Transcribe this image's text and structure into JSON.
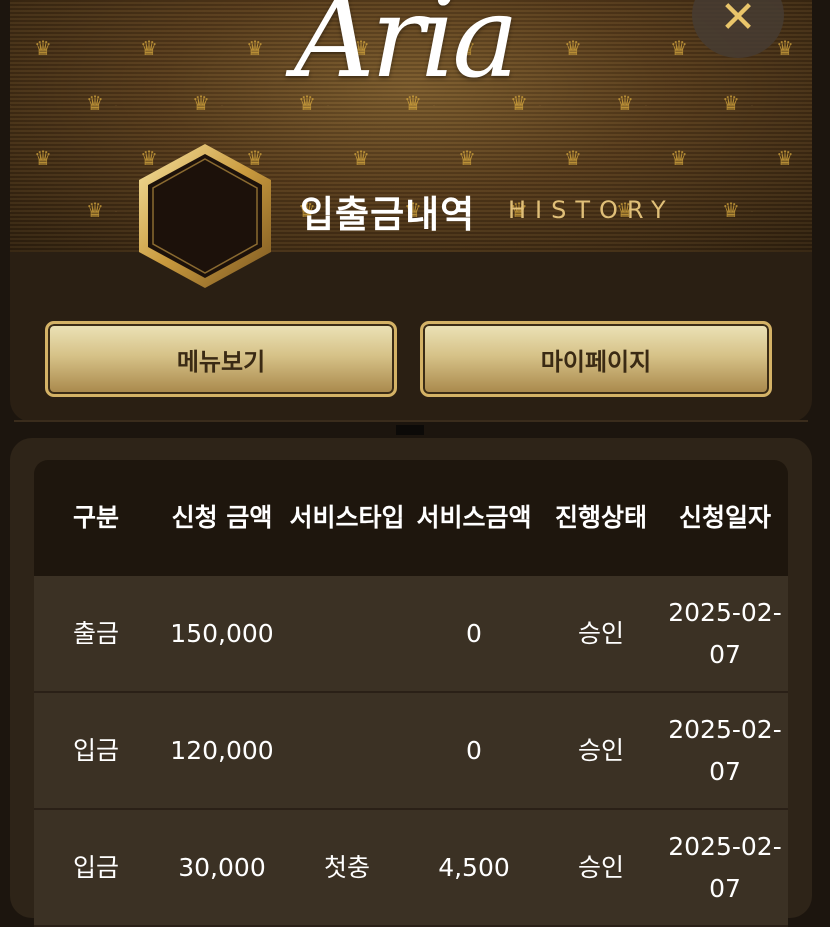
{
  "header": {
    "logo_text": "Aria",
    "close_icon": "close-icon",
    "title": "입출금내역",
    "title_en": "HISTORY"
  },
  "nav": {
    "menu_label": "메뉴보기",
    "mypage_label": "마이페이지"
  },
  "table": {
    "columns": [
      "구분",
      "신청 금액",
      "서비스타입",
      "서비스금액",
      "진행상태",
      "신청일자"
    ],
    "rows": [
      [
        "출금",
        "150,000",
        "",
        "0",
        "승인",
        "2025-02-07"
      ],
      [
        "입금",
        "120,000",
        "",
        "0",
        "승인",
        "2025-02-07"
      ],
      [
        "입금",
        "30,000",
        "첫충",
        "4,500",
        "승인",
        "2025-02-07"
      ]
    ]
  },
  "colors": {
    "background": "#1c150e",
    "gold": "#d4b266",
    "table_header": "#1e160d",
    "table_row": "#3b3124"
  }
}
